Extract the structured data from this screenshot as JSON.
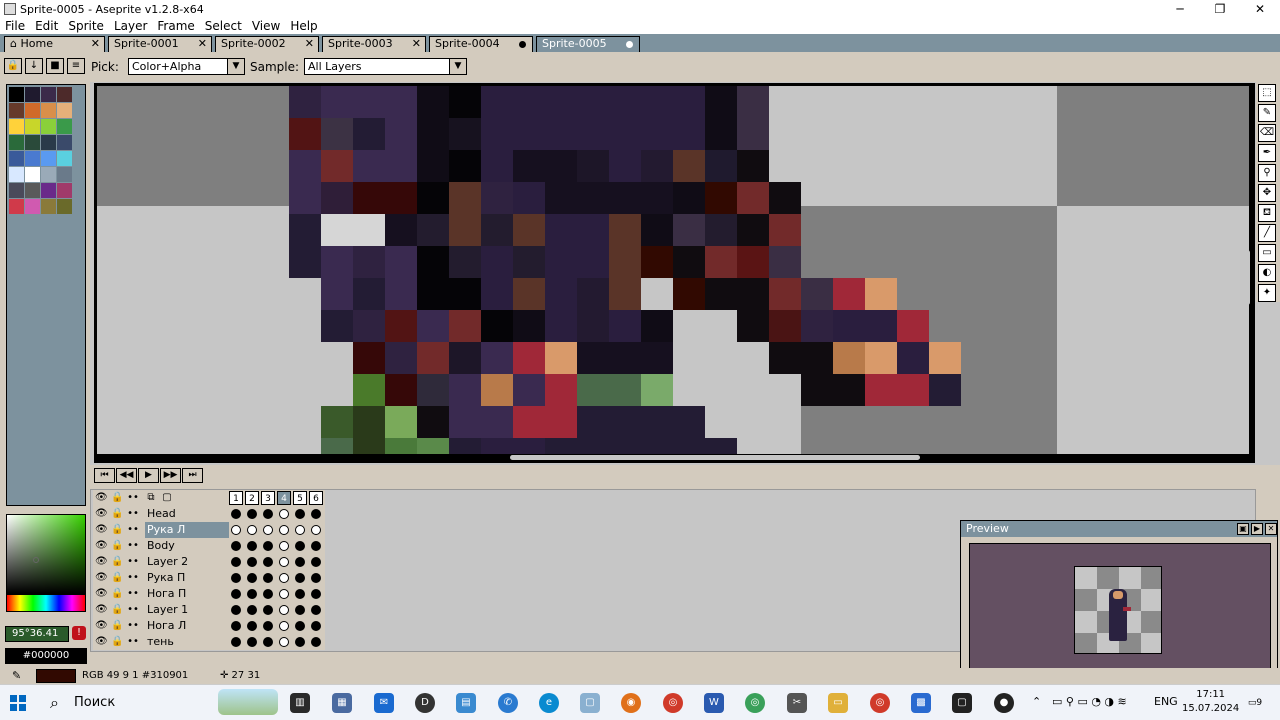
{
  "window": {
    "title": "Sprite-0005 - Aseprite v1.2.8-x64",
    "minimize": "─",
    "maximize": "❐",
    "close": "✕"
  },
  "menu": [
    "File",
    "Edit",
    "Sprite",
    "Layer",
    "Frame",
    "Select",
    "View",
    "Help"
  ],
  "tabs": [
    {
      "label": "Home",
      "state": "close"
    },
    {
      "label": "Sprite-0001",
      "state": "close"
    },
    {
      "label": "Sprite-0002",
      "state": "close"
    },
    {
      "label": "Sprite-0003",
      "state": "close"
    },
    {
      "label": "Sprite-0004",
      "state": "modified"
    },
    {
      "label": "Sprite-0005",
      "state": "active-modified"
    }
  ],
  "context_bar": {
    "pick_label": "Pick:",
    "pick_value": "Color+Alpha",
    "sample_label": "Sample:",
    "sample_value": "All Layers"
  },
  "palette_colors": [
    [
      "#000000",
      "#1f1a2e",
      "#3b2a4a",
      "#4d2a2a"
    ],
    [
      "#663a2a",
      "#d06a2a",
      "#d98f4a",
      "#e5b07a"
    ],
    [
      "#ffd23a",
      "#c8d62a",
      "#8ad03a",
      "#3a9a4a"
    ],
    [
      "#2a6a3a",
      "#2a4a3a",
      "#2a3a4a",
      "#3a4a6a"
    ],
    [
      "#3a5a9a",
      "#4a7ad0",
      "#5a9af0",
      "#5ad0e0"
    ],
    [
      "#d8e8ff",
      "#ffffff",
      "#9aaab8",
      "#6a7a8a"
    ],
    [
      "#4a4a5a",
      "#5a5a5a",
      "#6a2a8a",
      "#a03a6a"
    ],
    [
      "#d03a4a",
      "#d05ab0",
      "#8a7a3a",
      "#6a6a2a"
    ]
  ],
  "color": {
    "hsv": "95°36.41",
    "hex": "#000000"
  },
  "tools": [
    "marquee-icon",
    "pencil-icon",
    "eraser-icon",
    "eyedropper-icon",
    "zoom-icon",
    "move-icon",
    "fill-icon",
    "line-icon",
    "rectangle-icon",
    "blur-icon",
    "spray-icon"
  ],
  "timeline": {
    "controls": [
      "⏮",
      "◀◀",
      "▶",
      "▶▶",
      "⏭"
    ],
    "frames": [
      "1",
      "2",
      "3",
      "4",
      "5",
      "6"
    ],
    "current_frame": 4,
    "layers": [
      {
        "name": "Head",
        "cels": [
          1,
          1,
          1,
          0,
          1,
          1
        ],
        "selected": false
      },
      {
        "name": "Рука Л",
        "cels": [
          0,
          0,
          0,
          0,
          0,
          0
        ],
        "selected": true
      },
      {
        "name": "Body",
        "cels": [
          1,
          1,
          1,
          0,
          1,
          1
        ],
        "selected": false
      },
      {
        "name": "Layer 2",
        "cels": [
          1,
          1,
          1,
          0,
          1,
          1
        ],
        "selected": false
      },
      {
        "name": "Рука П",
        "cels": [
          1,
          1,
          1,
          0,
          1,
          1
        ],
        "selected": false
      },
      {
        "name": "Нога П",
        "cels": [
          1,
          1,
          1,
          0,
          1,
          1
        ],
        "selected": false
      },
      {
        "name": "Layer 1",
        "cels": [
          1,
          1,
          1,
          0,
          1,
          1
        ],
        "selected": false
      },
      {
        "name": "Нога Л",
        "cels": [
          1,
          1,
          1,
          0,
          1,
          1
        ],
        "selected": false
      },
      {
        "name": "тень",
        "cels": [
          1,
          1,
          1,
          0,
          1,
          1
        ],
        "selected": false
      }
    ]
  },
  "preview": {
    "title": "Preview"
  },
  "status": {
    "color_info": "RGB 49 9 1 #310901",
    "position": "✛ 27 31"
  },
  "taskbar": {
    "search_placeholder": "Поиск",
    "language": "ENG",
    "time": "17:11",
    "date": "15.07.2024",
    "notifications": "9"
  },
  "canvas_pixels": [
    {
      "r": 0,
      "c": 6,
      "col": "#2f2240"
    },
    {
      "r": 0,
      "c": 7,
      "col": "#3a2a50"
    },
    {
      "r": 0,
      "c": 8,
      "col": "#3a2a50"
    },
    {
      "r": 0,
      "c": 9,
      "col": "#3a2a50"
    },
    {
      "r": 0,
      "c": 10,
      "col": "#100c16"
    },
    {
      "r": 0,
      "c": 11,
      "col": "#050407"
    },
    {
      "r": 0,
      "c": 12,
      "col": "#2a1e3e"
    },
    {
      "r": 0,
      "c": 13,
      "col": "#2a1e3e"
    },
    {
      "r": 0,
      "c": 14,
      "col": "#2a1e3e"
    },
    {
      "r": 0,
      "c": 15,
      "col": "#2a1e3e"
    },
    {
      "r": 0,
      "c": 16,
      "col": "#2a1e3e"
    },
    {
      "r": 0,
      "c": 17,
      "col": "#2a1e3e"
    },
    {
      "r": 0,
      "c": 18,
      "col": "#2a1e3e"
    },
    {
      "r": 0,
      "c": 19,
      "col": "#100c16"
    },
    {
      "r": 0,
      "c": 20,
      "col": "#3a2e44"
    },
    {
      "r": 1,
      "c": 6,
      "col": "#521414"
    },
    {
      "r": 1,
      "c": 7,
      "col": "#3c3244"
    },
    {
      "r": 1,
      "c": 8,
      "col": "#231c34"
    },
    {
      "r": 1,
      "c": 9,
      "col": "#3a2a50"
    },
    {
      "r": 1,
      "c": 10,
      "col": "#100c16"
    },
    {
      "r": 1,
      "c": 11,
      "col": "#17121f"
    },
    {
      "r": 1,
      "c": 12,
      "col": "#2a1e3e"
    },
    {
      "r": 1,
      "c": 13,
      "col": "#2a1e3e"
    },
    {
      "r": 1,
      "c": 14,
      "col": "#2a1e3e"
    },
    {
      "r": 1,
      "c": 15,
      "col": "#2a1e3e"
    },
    {
      "r": 1,
      "c": 16,
      "col": "#2a1e3e"
    },
    {
      "r": 1,
      "c": 17,
      "col": "#2a1e3e"
    },
    {
      "r": 1,
      "c": 18,
      "col": "#2a1e3e"
    },
    {
      "r": 1,
      "c": 19,
      "col": "#100c16"
    },
    {
      "r": 1,
      "c": 20,
      "col": "#3a2e44"
    },
    {
      "r": 2,
      "c": 6,
      "col": "#3a2a50"
    },
    {
      "r": 2,
      "c": 7,
      "col": "#722a2a"
    },
    {
      "r": 2,
      "c": 8,
      "col": "#3a2a50"
    },
    {
      "r": 2,
      "c": 9,
      "col": "#3a2a50"
    },
    {
      "r": 2,
      "c": 10,
      "col": "#100c16"
    },
    {
      "r": 2,
      "c": 11,
      "col": "#050407"
    },
    {
      "r": 2,
      "c": 12,
      "col": "#2a1e3e"
    },
    {
      "r": 2,
      "c": 13,
      "col": "#16101f"
    },
    {
      "r": 2,
      "c": 14,
      "col": "#16101f"
    },
    {
      "r": 2,
      "c": 15,
      "col": "#1d1628"
    },
    {
      "r": 2,
      "c": 16,
      "col": "#2a1e3e"
    },
    {
      "r": 2,
      "c": 17,
      "col": "#231a30"
    },
    {
      "r": 2,
      "c": 18,
      "col": "#5a3428"
    },
    {
      "r": 2,
      "c": 19,
      "col": "#1f1a2e"
    },
    {
      "r": 2,
      "c": 20,
      "col": "#100c10"
    },
    {
      "r": 3,
      "c": 6,
      "col": "#3a2a50"
    },
    {
      "r": 3,
      "c": 7,
      "col": "#2f1e38"
    },
    {
      "r": 3,
      "c": 8,
      "col": "#360808"
    },
    {
      "r": 3,
      "c": 9,
      "col": "#360808"
    },
    {
      "r": 3,
      "c": 10,
      "col": "#050407"
    },
    {
      "r": 3,
      "c": 11,
      "col": "#5a3428"
    },
    {
      "r": 3,
      "c": 12,
      "col": "#2f2240"
    },
    {
      "r": 3,
      "c": 13,
      "col": "#2a1e3e"
    },
    {
      "r": 3,
      "c": 14,
      "col": "#16101f"
    },
    {
      "r": 3,
      "c": 15,
      "col": "#16101f"
    },
    {
      "r": 3,
      "c": 16,
      "col": "#16101f"
    },
    {
      "r": 3,
      "c": 17,
      "col": "#16101f"
    },
    {
      "r": 3,
      "c": 18,
      "col": "#100c16"
    },
    {
      "r": 3,
      "c": 19,
      "col": "#310901"
    },
    {
      "r": 3,
      "c": 20,
      "col": "#722a2a"
    },
    {
      "r": 3,
      "c": 21,
      "col": "#100c10"
    },
    {
      "r": 4,
      "c": 6,
      "col": "#231c34"
    },
    {
      "r": 4,
      "c": 7,
      "col": "#d6d6d6"
    },
    {
      "r": 4,
      "c": 8,
      "col": "#d6d6d6"
    },
    {
      "r": 4,
      "c": 9,
      "col": "#16101f"
    },
    {
      "r": 4,
      "c": 10,
      "col": "#231c2e"
    },
    {
      "r": 4,
      "c": 11,
      "col": "#5a3428"
    },
    {
      "r": 4,
      "c": 12,
      "col": "#231c2e"
    },
    {
      "r": 4,
      "c": 13,
      "col": "#5a3428"
    },
    {
      "r": 4,
      "c": 14,
      "col": "#2a1e3e"
    },
    {
      "r": 4,
      "c": 15,
      "col": "#2a1e3e"
    },
    {
      "r": 4,
      "c": 16,
      "col": "#5a3428"
    },
    {
      "r": 4,
      "c": 17,
      "col": "#100c16"
    },
    {
      "r": 4,
      "c": 18,
      "col": "#3a2e44"
    },
    {
      "r": 4,
      "c": 19,
      "col": "#231c2e"
    },
    {
      "r": 4,
      "c": 20,
      "col": "#100c10"
    },
    {
      "r": 4,
      "c": 21,
      "col": "#722a2a"
    },
    {
      "r": 5,
      "c": 6,
      "col": "#231c34"
    },
    {
      "r": 5,
      "c": 7,
      "col": "#3a2a50"
    },
    {
      "r": 5,
      "c": 8,
      "col": "#2f2240"
    },
    {
      "r": 5,
      "c": 9,
      "col": "#3a2a50"
    },
    {
      "r": 5,
      "c": 10,
      "col": "#050407"
    },
    {
      "r": 5,
      "c": 11,
      "col": "#231c2e"
    },
    {
      "r": 5,
      "c": 12,
      "col": "#2a1e3e"
    },
    {
      "r": 5,
      "c": 13,
      "col": "#231c2e"
    },
    {
      "r": 5,
      "c": 14,
      "col": "#2a1e3e"
    },
    {
      "r": 5,
      "c": 15,
      "col": "#2a1e3e"
    },
    {
      "r": 5,
      "c": 16,
      "col": "#5a3428"
    },
    {
      "r": 5,
      "c": 17,
      "col": "#310901"
    },
    {
      "r": 5,
      "c": 18,
      "col": "#100c10"
    },
    {
      "r": 5,
      "c": 19,
      "col": "#722a2a"
    },
    {
      "r": 5,
      "c": 20,
      "col": "#5a1414"
    },
    {
      "r": 5,
      "c": 21,
      "col": "#3a2e44"
    },
    {
      "r": 6,
      "c": 7,
      "col": "#3a2a50"
    },
    {
      "r": 6,
      "c": 8,
      "col": "#231c34"
    },
    {
      "r": 6,
      "c": 9,
      "col": "#3a2a50"
    },
    {
      "r": 6,
      "c": 10,
      "col": "#050407"
    },
    {
      "r": 6,
      "c": 11,
      "col": "#050407"
    },
    {
      "r": 6,
      "c": 12,
      "col": "#2a1e3e"
    },
    {
      "r": 6,
      "c": 13,
      "col": "#5a3428"
    },
    {
      "r": 6,
      "c": 14,
      "col": "#2a1e3e"
    },
    {
      "r": 6,
      "c": 15,
      "col": "#231a30"
    },
    {
      "r": 6,
      "c": 16,
      "col": "#5a3428"
    },
    {
      "r": 6,
      "c": 18,
      "col": "#310901"
    },
    {
      "r": 6,
      "c": 19,
      "col": "#100c10"
    },
    {
      "r": 6,
      "c": 20,
      "col": "#100c10"
    },
    {
      "r": 6,
      "c": 21,
      "col": "#722a2a"
    },
    {
      "r": 6,
      "c": 22,
      "col": "#3a2e44"
    },
    {
      "r": 6,
      "c": 23,
      "col": "#a02838"
    },
    {
      "r": 6,
      "c": 24,
      "col": "#d99a6a"
    },
    {
      "r": 7,
      "c": 7,
      "col": "#231c34"
    },
    {
      "r": 7,
      "c": 8,
      "col": "#2f2240"
    },
    {
      "r": 7,
      "c": 9,
      "col": "#521414"
    },
    {
      "r": 7,
      "c": 10,
      "col": "#3a2a50"
    },
    {
      "r": 7,
      "c": 11,
      "col": "#722a2a"
    },
    {
      "r": 7,
      "c": 12,
      "col": "#050407"
    },
    {
      "r": 7,
      "c": 13,
      "col": "#100c16"
    },
    {
      "r": 7,
      "c": 14,
      "col": "#2a1e3e"
    },
    {
      "r": 7,
      "c": 15,
      "col": "#231a30"
    },
    {
      "r": 7,
      "c": 16,
      "col": "#2a1e3e"
    },
    {
      "r": 7,
      "c": 17,
      "col": "#100c16"
    },
    {
      "r": 7,
      "c": 20,
      "col": "#100c10"
    },
    {
      "r": 7,
      "c": 21,
      "col": "#4a1414"
    },
    {
      "r": 7,
      "c": 22,
      "col": "#2f2240"
    },
    {
      "r": 7,
      "c": 23,
      "col": "#2a1e3e"
    },
    {
      "r": 7,
      "c": 24,
      "col": "#2a1e3e"
    },
    {
      "r": 7,
      "c": 25,
      "col": "#a02838"
    },
    {
      "r": 8,
      "c": 8,
      "col": "#360808"
    },
    {
      "r": 8,
      "c": 9,
      "col": "#2f2240"
    },
    {
      "r": 8,
      "c": 10,
      "col": "#722a2a"
    },
    {
      "r": 8,
      "c": 11,
      "col": "#1d1628"
    },
    {
      "r": 8,
      "c": 12,
      "col": "#3a2a50"
    },
    {
      "r": 8,
      "c": 13,
      "col": "#a02838"
    },
    {
      "r": 8,
      "c": 14,
      "col": "#d99a6a"
    },
    {
      "r": 8,
      "c": 15,
      "col": "#16101f"
    },
    {
      "r": 8,
      "c": 16,
      "col": "#16101f"
    },
    {
      "r": 8,
      "c": 17,
      "col": "#16101f"
    },
    {
      "r": 8,
      "c": 21,
      "col": "#100c10"
    },
    {
      "r": 8,
      "c": 22,
      "col": "#100c10"
    },
    {
      "r": 8,
      "c": 23,
      "col": "#b87a4a"
    },
    {
      "r": 8,
      "c": 24,
      "col": "#d99a6a"
    },
    {
      "r": 8,
      "c": 25,
      "col": "#2a1e3e"
    },
    {
      "r": 8,
      "c": 26,
      "col": "#d99a6a"
    },
    {
      "r": 9,
      "c": 8,
      "col": "#4a7a2a"
    },
    {
      "r": 9,
      "c": 9,
      "col": "#360808"
    },
    {
      "r": 9,
      "c": 10,
      "col": "#2f2a3a"
    },
    {
      "r": 9,
      "c": 11,
      "col": "#3a2a50"
    },
    {
      "r": 9,
      "c": 12,
      "col": "#b87a4a"
    },
    {
      "r": 9,
      "c": 13,
      "col": "#3a2a50"
    },
    {
      "r": 9,
      "c": 14,
      "col": "#a02838"
    },
    {
      "r": 9,
      "c": 15,
      "col": "#4a6a4a"
    },
    {
      "r": 9,
      "c": 16,
      "col": "#4a6a4a"
    },
    {
      "r": 9,
      "c": 17,
      "col": "#7aaa6a"
    },
    {
      "r": 9,
      "c": 22,
      "col": "#100c10"
    },
    {
      "r": 9,
      "c": 23,
      "col": "#100c10"
    },
    {
      "r": 9,
      "c": 24,
      "col": "#a02838"
    },
    {
      "r": 9,
      "c": 25,
      "col": "#a02838"
    },
    {
      "r": 9,
      "c": 26,
      "col": "#231c34"
    },
    {
      "r": 10,
      "c": 7,
      "col": "#3a5a2a"
    },
    {
      "r": 10,
      "c": 8,
      "col": "#2a3a1a"
    },
    {
      "r": 10,
      "c": 9,
      "col": "#7aaa5a"
    },
    {
      "r": 10,
      "c": 10,
      "col": "#100c10"
    },
    {
      "r": 10,
      "c": 11,
      "col": "#3a2a50"
    },
    {
      "r": 10,
      "c": 12,
      "col": "#3a2a50"
    },
    {
      "r": 10,
      "c": 13,
      "col": "#a02838"
    },
    {
      "r": 10,
      "c": 14,
      "col": "#a02838"
    },
    {
      "r": 10,
      "c": 15,
      "col": "#231c34"
    },
    {
      "r": 10,
      "c": 16,
      "col": "#231c34"
    },
    {
      "r": 10,
      "c": 17,
      "col": "#231c34"
    },
    {
      "r": 10,
      "c": 18,
      "col": "#231c34"
    },
    {
      "r": 11,
      "c": 7,
      "col": "#4a6a4a"
    },
    {
      "r": 11,
      "c": 8,
      "col": "#2a3a1a"
    },
    {
      "r": 11,
      "c": 9,
      "col": "#4a7a3a"
    },
    {
      "r": 11,
      "c": 10,
      "col": "#5a8a4a"
    },
    {
      "r": 11,
      "c": 11,
      "col": "#231c34"
    },
    {
      "r": 11,
      "c": 12,
      "col": "#2a1e3e"
    },
    {
      "r": 11,
      "c": 13,
      "col": "#2a1e3e"
    },
    {
      "r": 11,
      "c": 14,
      "col": "#231c34"
    },
    {
      "r": 11,
      "c": 15,
      "col": "#231c34"
    },
    {
      "r": 11,
      "c": 16,
      "col": "#231c34"
    },
    {
      "r": 11,
      "c": 17,
      "col": "#231c34"
    },
    {
      "r": 11,
      "c": 18,
      "col": "#231c34"
    },
    {
      "r": 11,
      "c": 19,
      "col": "#231c34"
    }
  ]
}
